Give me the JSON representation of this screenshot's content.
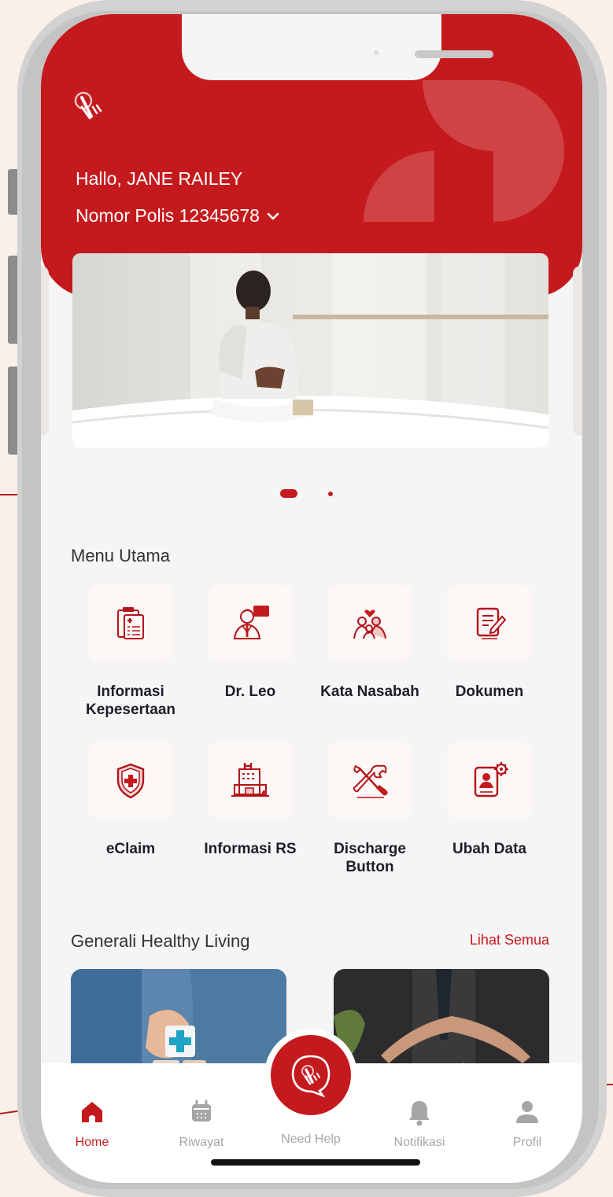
{
  "header": {
    "greeting": "Hallo, JANE RAILEY",
    "policy_label": "Nomor Polis 12345678"
  },
  "banner": {
    "slides": 2,
    "active_slide": 1
  },
  "main_menu": {
    "title": "Menu Utama",
    "items": [
      {
        "label": "Informasi Kepesertaan",
        "icon": "clipboard-medical-icon"
      },
      {
        "label": "Dr. Leo",
        "icon": "doctor-icon"
      },
      {
        "label": "Kata Nasabah",
        "icon": "family-icon"
      },
      {
        "label": "Dokumen",
        "icon": "document-edit-icon"
      },
      {
        "label": "eClaim",
        "icon": "shield-cross-icon"
      },
      {
        "label": "Informasi RS",
        "icon": "hospital-icon"
      },
      {
        "label": "Discharge Button",
        "icon": "tools-icon"
      },
      {
        "label": "Ubah Data",
        "icon": "profile-settings-icon"
      }
    ]
  },
  "healthy_living": {
    "title": "Generali Healthy Living",
    "see_all": "Lihat Semua"
  },
  "bottom_nav": {
    "home": "Home",
    "history": "Riwayat",
    "help": "Need Help",
    "notifications": "Notifikasi",
    "profile": "Profil"
  },
  "colors": {
    "brand_red": "#c51a1d",
    "background": "#f6f5f5",
    "inactive": "#a6a6a6"
  }
}
